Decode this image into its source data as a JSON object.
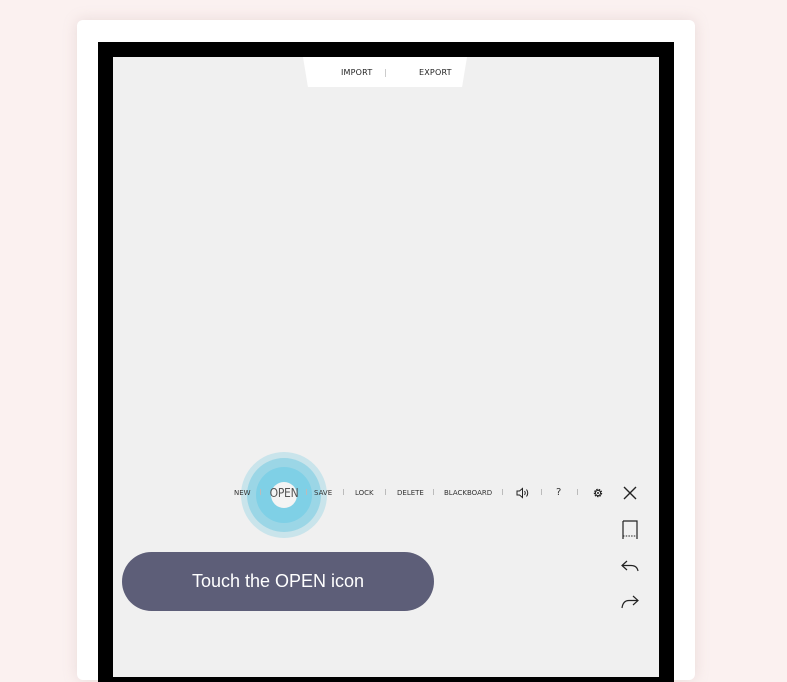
{
  "top_menu": {
    "import_label": "IMPORT",
    "export_label": "EXPORT"
  },
  "toolbar": {
    "new_label": "NEW",
    "open_label": "OPEN",
    "save_label": "SAVE",
    "lock_label": "LOCK",
    "delete_label": "DELETE",
    "blackboard_label": "BLACKBOARD",
    "help_label": "?"
  },
  "side_icons": [
    "close-icon",
    "bookmark-icon",
    "undo-icon",
    "redo-icon"
  ],
  "toolbar_icons": [
    "speaker-icon",
    "gear-icon"
  ],
  "hint": {
    "text": "Touch the OPEN icon"
  },
  "colors": {
    "page_bg": "#fbf1f0",
    "screen_bg": "#f0f0f0",
    "ripple": "#7fd0e6",
    "hint_bg": "#5d5e78"
  }
}
